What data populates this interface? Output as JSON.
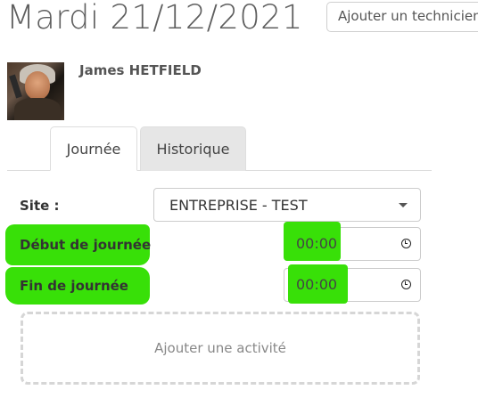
{
  "header": {
    "date_title": "Mardi 21/12/2021",
    "technician_placeholder": "Ajouter un technicien"
  },
  "user": {
    "name": "James HETFIELD"
  },
  "tabs": [
    {
      "label": "Journée",
      "active": true
    },
    {
      "label": "Historique",
      "active": false
    }
  ],
  "form": {
    "site_label": "Site :",
    "site_value": "ENTREPRISE - TEST",
    "start_label": "Début de journée",
    "start_value": "00:00",
    "end_label": "Fin de journée",
    "end_value": "00:00"
  },
  "add_activity_label": "Ajouter une activité",
  "colors": {
    "highlight": "#38e008"
  }
}
